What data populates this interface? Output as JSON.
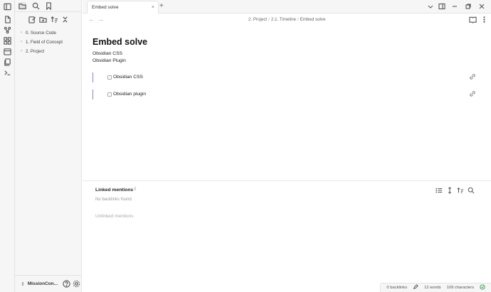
{
  "tab": {
    "title": "Embed solve",
    "close": "×",
    "new": "+"
  },
  "breadcrumb": {
    "items": [
      "2. Project",
      "2.1. Timeline",
      "Embed solve"
    ],
    "separator": "/"
  },
  "nav": {
    "back": "←",
    "forward": "→"
  },
  "sidebar": {
    "tree": [
      {
        "label": "0. Source Code",
        "chevron": "›"
      },
      {
        "label": "1. Field of Concept",
        "chevron": "›"
      },
      {
        "label": "2. Project",
        "chevron": "›"
      }
    ],
    "vault": {
      "name": "MissionCon...",
      "toggle": "⇕"
    }
  },
  "note": {
    "title": "Embed solve",
    "lines": [
      "Obsidian CSS",
      "Obsidian Plugin"
    ],
    "embeds": [
      {
        "label": "Obsidian CSS"
      },
      {
        "label": "Obsidian plugin"
      }
    ]
  },
  "backlinks": {
    "heading": "Linked mentions",
    "count": "0",
    "empty": "No backlinks found.",
    "unlinked": "Unlinked mentions"
  },
  "status": {
    "backlinks": "0 backlinks",
    "words": "12 words",
    "characters": "109 characters"
  },
  "colors": {
    "accent": "#8b7fd1",
    "sync_ok": "#3aa655"
  }
}
